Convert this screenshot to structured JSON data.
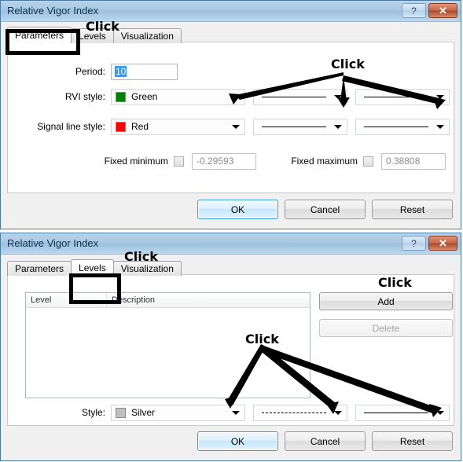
{
  "dialogs": [
    {
      "title": "Relative Vigor Index",
      "help_label": "?",
      "close_label": "✕",
      "tabs": [
        {
          "label": "Parameters",
          "active": true
        },
        {
          "label": "Levels",
          "active": false
        },
        {
          "label": "Visualization",
          "active": false
        }
      ],
      "fields": {
        "period_label": "Period:",
        "period_value": "10",
        "rvi_label": "RVI style:",
        "rvi_color_name": "Green",
        "rvi_color_hex": "#008000",
        "signal_label": "Signal line style:",
        "signal_color_name": "Red",
        "signal_color_hex": "#FF0000",
        "fixed_min_label": "Fixed minimum",
        "fixed_min_value": "-0.29593",
        "fixed_max_label": "Fixed maximum",
        "fixed_max_value": "0.38808"
      },
      "footer": {
        "ok_label": "OK",
        "cancel_label": "Cancel",
        "reset_label": "Reset"
      }
    },
    {
      "title": "Relative Vigor Index",
      "help_label": "?",
      "close_label": "✕",
      "tabs": [
        {
          "label": "Parameters",
          "active": false
        },
        {
          "label": "Levels",
          "active": true
        },
        {
          "label": "Visualization",
          "active": false
        }
      ],
      "list": {
        "col_level": "Level",
        "col_description": "Description",
        "rows": []
      },
      "buttons": {
        "add_label": "Add",
        "delete_label": "Delete"
      },
      "style_row": {
        "style_label": "Style:",
        "color_name": "Silver",
        "color_hex": "#C0C0C0"
      },
      "footer": {
        "ok_label": "OK",
        "cancel_label": "Cancel",
        "reset_label": "Reset"
      }
    }
  ],
  "annotations": {
    "click_1": "Click",
    "click_2": "Click",
    "click_3": "Click",
    "click_4": "Click",
    "click_5": "Click"
  }
}
